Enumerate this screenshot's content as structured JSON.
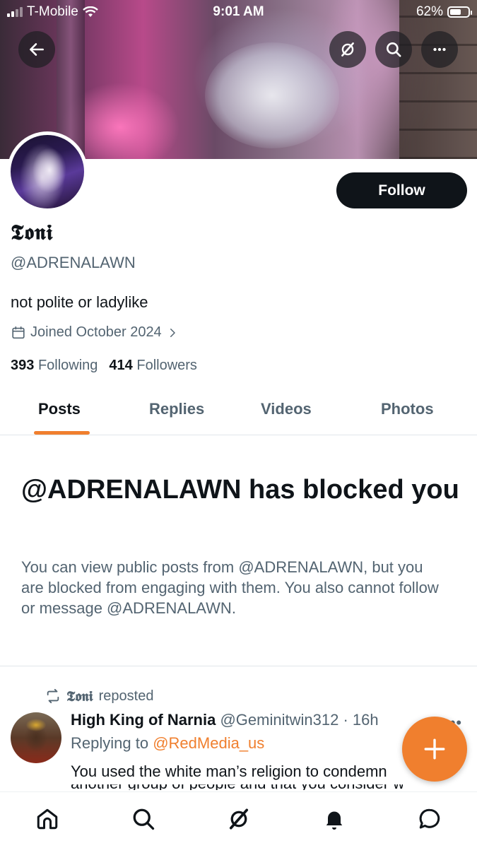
{
  "status_bar": {
    "carrier": "T-Mobile",
    "time": "9:01 AM",
    "battery": "62%",
    "battery_level": 0.62
  },
  "header": {
    "back_icon": "arrow-left-icon",
    "grok_icon": "grok-icon",
    "search_icon": "search-icon",
    "more_icon": "more-horizontal-icon"
  },
  "profile": {
    "display_name": "𝕿𝖔𝖓𝖎",
    "handle": "@ADRENALAWN",
    "bio": "not polite or ladylike",
    "joined": "Joined October 2024",
    "following_count": "393",
    "following_label": "Following",
    "followers_count": "414",
    "followers_label": "Followers",
    "follow_button": "Follow"
  },
  "tabs": [
    {
      "label": "Posts",
      "active": true
    },
    {
      "label": "Replies",
      "active": false
    },
    {
      "label": "Videos",
      "active": false
    },
    {
      "label": "Photos",
      "active": false
    }
  ],
  "blocked": {
    "title": "@ADRENALAWN has blocked you",
    "body": "You can view public posts from @ADRENALAWN, but you are blocked from engaging with them. You also cannot follow or message @ADRENALAWN."
  },
  "tweet": {
    "repost_name": "𝕿𝖔𝖓𝖎",
    "repost_suffix": "reposted",
    "author_name": "High King of Narnia",
    "author_handle": "@Geminitwin312",
    "separator": "·",
    "time_ago": "16h",
    "replying_label": "Replying to",
    "replying_to": "@RedMedia_us",
    "text_line1": "You used the white man’s religion to condemn",
    "text_line2": "another group of people and that you consider white"
  },
  "fab": {
    "icon": "plus-icon"
  },
  "bottom_nav": [
    "home-icon",
    "search-icon",
    "grok-icon",
    "notifications-icon",
    "messages-icon"
  ],
  "colors": {
    "accent": "#f07f2e",
    "text_primary": "#0f1419",
    "text_secondary": "#536471",
    "follow_bg": "#0f1419"
  }
}
